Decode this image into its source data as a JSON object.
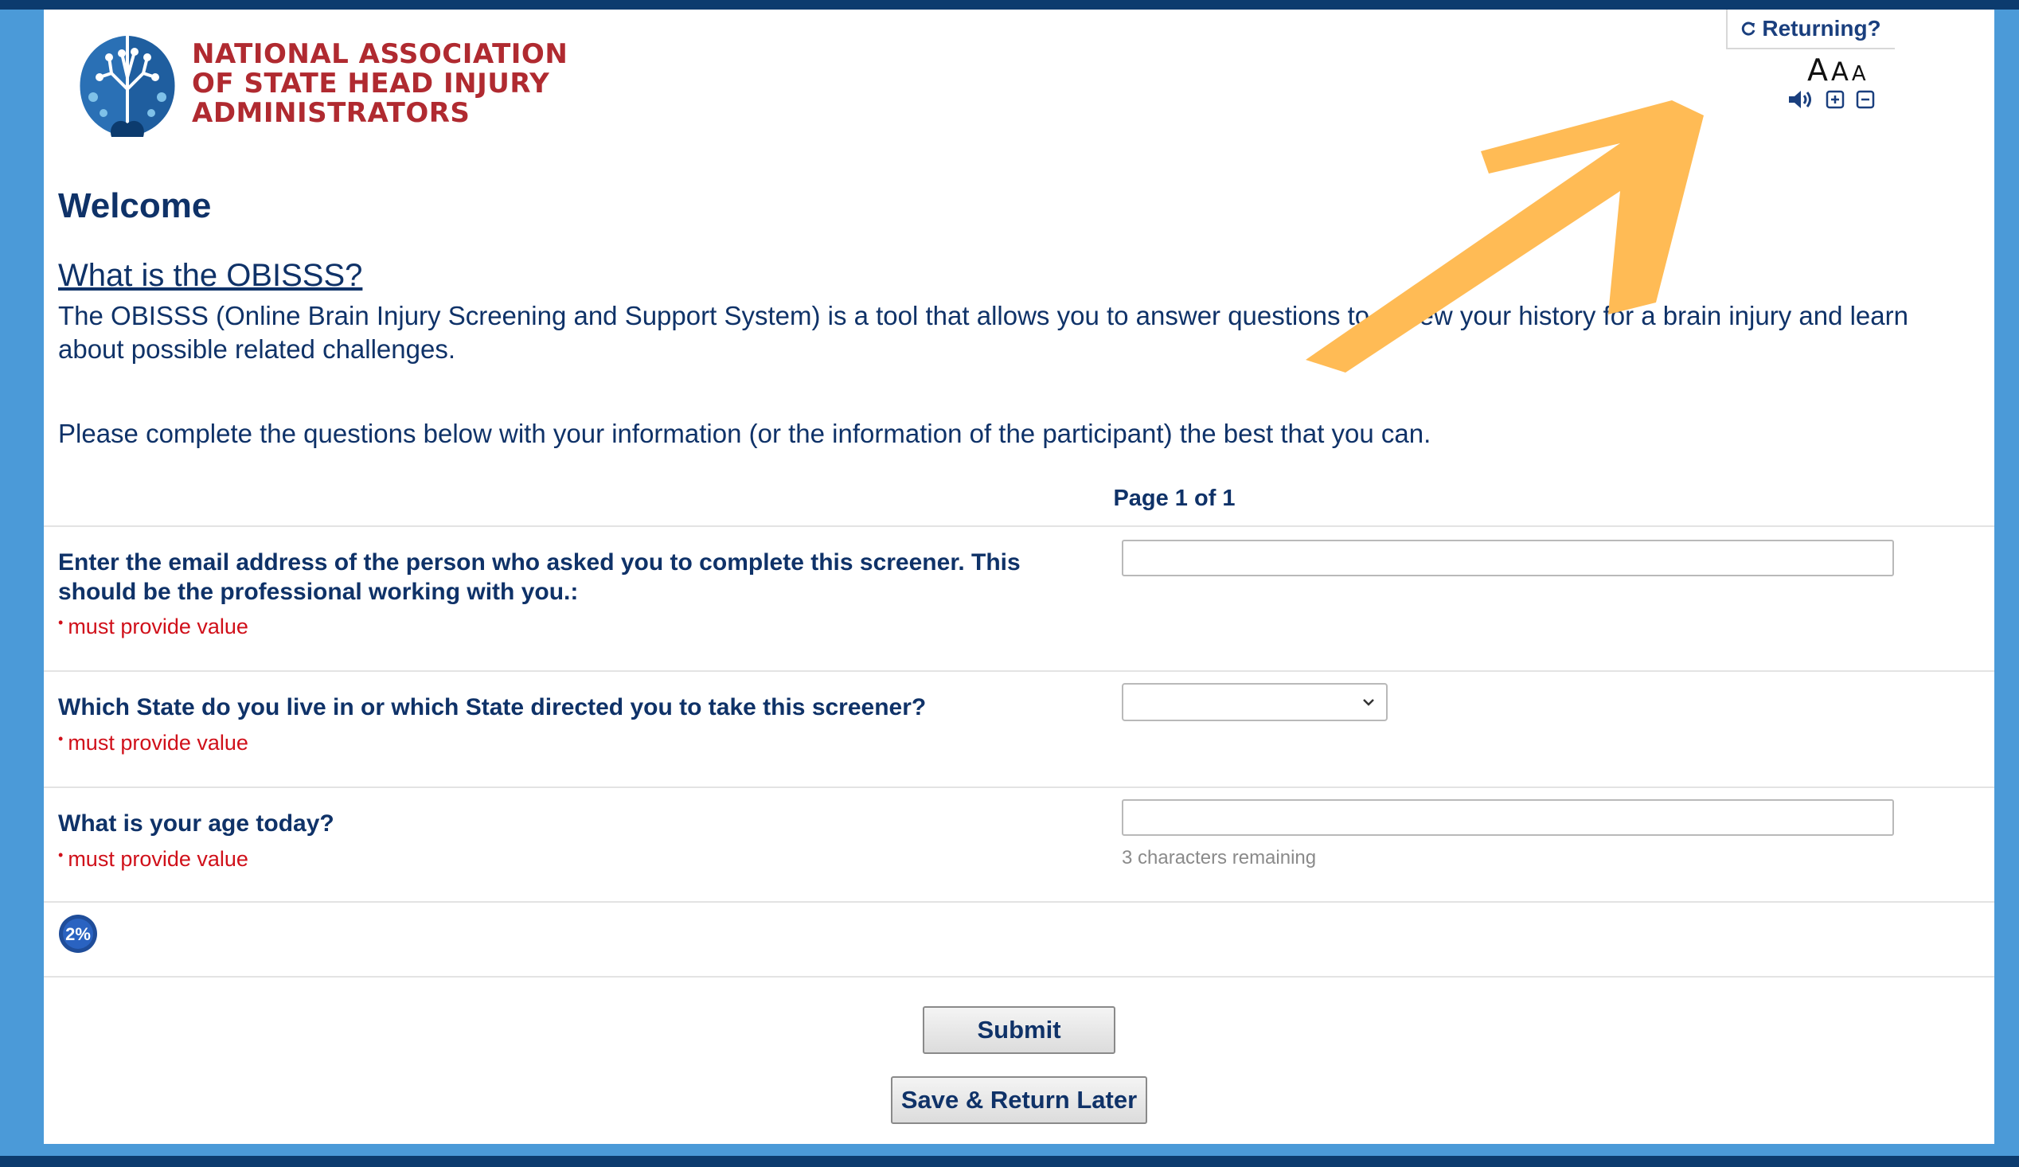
{
  "header": {
    "org_name_lines": [
      "NATIONAL ASSOCIATION",
      "OF STATE HEAD INJURY",
      "ADMINISTRATORS"
    ],
    "returning_label": "Returning?",
    "font_size_controls": [
      "A",
      "A",
      "A"
    ],
    "tool_icons": [
      "speaker-icon",
      "zoom-in-icon",
      "zoom-out-icon"
    ]
  },
  "intro": {
    "welcome": "Welcome",
    "what_is": "What is the OBISSS?",
    "description": "The OBISSS (Online Brain Injury Screening and Support System) is a tool that allows you to answer questions to review your history for a brain injury and learn about possible related challenges.",
    "instructions": "Please complete the questions below with your information (or the information of the participant) the best that you can."
  },
  "pagination": {
    "label": "Page 1 of 1"
  },
  "questions": [
    {
      "label": "Enter the email address of the person who asked you to complete this screener. This should be the professional working with you.:",
      "required": "must provide value",
      "value": ""
    },
    {
      "label": "Which State do you live in or which State directed you to take this screener?",
      "required": "must provide value",
      "selected": ""
    },
    {
      "label": "What is your age today?",
      "required": "must provide value",
      "value": "",
      "chars_remaining": "3 characters remaining"
    }
  ],
  "progress": {
    "label": "2%"
  },
  "buttons": {
    "submit": "Submit",
    "save_return": "Save & Return Later"
  },
  "colors": {
    "frame_blue": "#4b9ad8",
    "navy": "#0f3268",
    "logo_red": "#b02a30",
    "required_red": "#d0101a",
    "annotation_orange": "#ffbb55"
  }
}
